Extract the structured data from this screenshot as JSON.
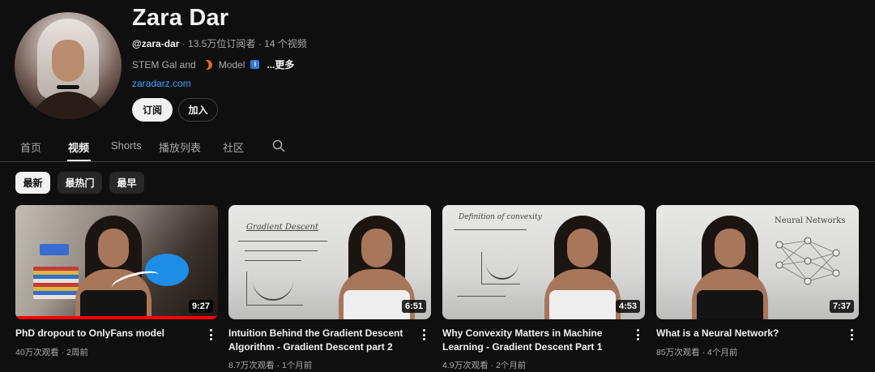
{
  "channel": {
    "name": "Zara Dar",
    "handle": "@zara-dar",
    "stats": " · 13.5万位订阅者 · 14 个视频",
    "description_prefix": "STEM Gal and",
    "description_mid": "Model",
    "more": "...更多",
    "website": "zaradarz.com",
    "subscribe_label": "订阅",
    "join_label": "加入"
  },
  "tabs": [
    {
      "label": "首页"
    },
    {
      "label": "视频",
      "active": true
    },
    {
      "label": "Shorts"
    },
    {
      "label": "播放列表"
    },
    {
      "label": "社区"
    }
  ],
  "filters": [
    {
      "label": "最新",
      "active": true
    },
    {
      "label": "最热门"
    },
    {
      "label": "最早"
    }
  ],
  "videos": [
    {
      "title": "PhD dropout to OnlyFans model",
      "views": "40万次观看",
      "age": "2周前",
      "duration": "9:27",
      "watched_fraction": 1.0
    },
    {
      "title": "Intuition Behind the Gradient Descent Algorithm - Gradient Descent part 2",
      "views": "8.7万次观看",
      "age": "1个月前",
      "duration": "6:51",
      "thumb_text": "Gradient Descent"
    },
    {
      "title": "Why Convexity Matters in Machine Learning - Gradient Descent Part 1",
      "views": "4.9万次观看",
      "age": "2个月前",
      "duration": "4:53",
      "thumb_text": "Definition of convexity"
    },
    {
      "title": "What is a Neural Network?",
      "views": "85万次观看",
      "age": "4个月前",
      "duration": "7:37",
      "thumb_text": "Neural Networks"
    }
  ],
  "colors": {
    "background": "#0f0f0f",
    "link": "#3ea6ff",
    "progress": "#ff0000",
    "muted_text": "#aaaaaa"
  },
  "icons": [
    "search-icon",
    "kebab-menu-icon",
    "moon-icon",
    "info-icon"
  ]
}
